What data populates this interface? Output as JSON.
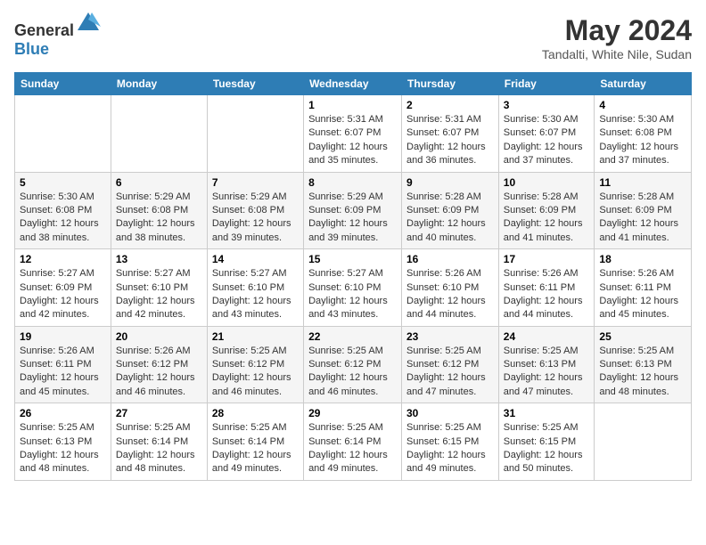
{
  "logo": {
    "general": "General",
    "blue": "Blue"
  },
  "title": "May 2024",
  "location": "Tandalti, White Nile, Sudan",
  "days_header": [
    "Sunday",
    "Monday",
    "Tuesday",
    "Wednesday",
    "Thursday",
    "Friday",
    "Saturday"
  ],
  "weeks": [
    [
      {
        "day": "",
        "sunrise": "",
        "sunset": "",
        "daylight": ""
      },
      {
        "day": "",
        "sunrise": "",
        "sunset": "",
        "daylight": ""
      },
      {
        "day": "",
        "sunrise": "",
        "sunset": "",
        "daylight": ""
      },
      {
        "day": "1",
        "sunrise": "Sunrise: 5:31 AM",
        "sunset": "Sunset: 6:07 PM",
        "daylight": "Daylight: 12 hours and 35 minutes."
      },
      {
        "day": "2",
        "sunrise": "Sunrise: 5:31 AM",
        "sunset": "Sunset: 6:07 PM",
        "daylight": "Daylight: 12 hours and 36 minutes."
      },
      {
        "day": "3",
        "sunrise": "Sunrise: 5:30 AM",
        "sunset": "Sunset: 6:07 PM",
        "daylight": "Daylight: 12 hours and 37 minutes."
      },
      {
        "day": "4",
        "sunrise": "Sunrise: 5:30 AM",
        "sunset": "Sunset: 6:08 PM",
        "daylight": "Daylight: 12 hours and 37 minutes."
      }
    ],
    [
      {
        "day": "5",
        "sunrise": "Sunrise: 5:30 AM",
        "sunset": "Sunset: 6:08 PM",
        "daylight": "Daylight: 12 hours and 38 minutes."
      },
      {
        "day": "6",
        "sunrise": "Sunrise: 5:29 AM",
        "sunset": "Sunset: 6:08 PM",
        "daylight": "Daylight: 12 hours and 38 minutes."
      },
      {
        "day": "7",
        "sunrise": "Sunrise: 5:29 AM",
        "sunset": "Sunset: 6:08 PM",
        "daylight": "Daylight: 12 hours and 39 minutes."
      },
      {
        "day": "8",
        "sunrise": "Sunrise: 5:29 AM",
        "sunset": "Sunset: 6:09 PM",
        "daylight": "Daylight: 12 hours and 39 minutes."
      },
      {
        "day": "9",
        "sunrise": "Sunrise: 5:28 AM",
        "sunset": "Sunset: 6:09 PM",
        "daylight": "Daylight: 12 hours and 40 minutes."
      },
      {
        "day": "10",
        "sunrise": "Sunrise: 5:28 AM",
        "sunset": "Sunset: 6:09 PM",
        "daylight": "Daylight: 12 hours and 41 minutes."
      },
      {
        "day": "11",
        "sunrise": "Sunrise: 5:28 AM",
        "sunset": "Sunset: 6:09 PM",
        "daylight": "Daylight: 12 hours and 41 minutes."
      }
    ],
    [
      {
        "day": "12",
        "sunrise": "Sunrise: 5:27 AM",
        "sunset": "Sunset: 6:09 PM",
        "daylight": "Daylight: 12 hours and 42 minutes."
      },
      {
        "day": "13",
        "sunrise": "Sunrise: 5:27 AM",
        "sunset": "Sunset: 6:10 PM",
        "daylight": "Daylight: 12 hours and 42 minutes."
      },
      {
        "day": "14",
        "sunrise": "Sunrise: 5:27 AM",
        "sunset": "Sunset: 6:10 PM",
        "daylight": "Daylight: 12 hours and 43 minutes."
      },
      {
        "day": "15",
        "sunrise": "Sunrise: 5:27 AM",
        "sunset": "Sunset: 6:10 PM",
        "daylight": "Daylight: 12 hours and 43 minutes."
      },
      {
        "day": "16",
        "sunrise": "Sunrise: 5:26 AM",
        "sunset": "Sunset: 6:10 PM",
        "daylight": "Daylight: 12 hours and 44 minutes."
      },
      {
        "day": "17",
        "sunrise": "Sunrise: 5:26 AM",
        "sunset": "Sunset: 6:11 PM",
        "daylight": "Daylight: 12 hours and 44 minutes."
      },
      {
        "day": "18",
        "sunrise": "Sunrise: 5:26 AM",
        "sunset": "Sunset: 6:11 PM",
        "daylight": "Daylight: 12 hours and 45 minutes."
      }
    ],
    [
      {
        "day": "19",
        "sunrise": "Sunrise: 5:26 AM",
        "sunset": "Sunset: 6:11 PM",
        "daylight": "Daylight: 12 hours and 45 minutes."
      },
      {
        "day": "20",
        "sunrise": "Sunrise: 5:26 AM",
        "sunset": "Sunset: 6:12 PM",
        "daylight": "Daylight: 12 hours and 46 minutes."
      },
      {
        "day": "21",
        "sunrise": "Sunrise: 5:25 AM",
        "sunset": "Sunset: 6:12 PM",
        "daylight": "Daylight: 12 hours and 46 minutes."
      },
      {
        "day": "22",
        "sunrise": "Sunrise: 5:25 AM",
        "sunset": "Sunset: 6:12 PM",
        "daylight": "Daylight: 12 hours and 46 minutes."
      },
      {
        "day": "23",
        "sunrise": "Sunrise: 5:25 AM",
        "sunset": "Sunset: 6:12 PM",
        "daylight": "Daylight: 12 hours and 47 minutes."
      },
      {
        "day": "24",
        "sunrise": "Sunrise: 5:25 AM",
        "sunset": "Sunset: 6:13 PM",
        "daylight": "Daylight: 12 hours and 47 minutes."
      },
      {
        "day": "25",
        "sunrise": "Sunrise: 5:25 AM",
        "sunset": "Sunset: 6:13 PM",
        "daylight": "Daylight: 12 hours and 48 minutes."
      }
    ],
    [
      {
        "day": "26",
        "sunrise": "Sunrise: 5:25 AM",
        "sunset": "Sunset: 6:13 PM",
        "daylight": "Daylight: 12 hours and 48 minutes."
      },
      {
        "day": "27",
        "sunrise": "Sunrise: 5:25 AM",
        "sunset": "Sunset: 6:14 PM",
        "daylight": "Daylight: 12 hours and 48 minutes."
      },
      {
        "day": "28",
        "sunrise": "Sunrise: 5:25 AM",
        "sunset": "Sunset: 6:14 PM",
        "daylight": "Daylight: 12 hours and 49 minutes."
      },
      {
        "day": "29",
        "sunrise": "Sunrise: 5:25 AM",
        "sunset": "Sunset: 6:14 PM",
        "daylight": "Daylight: 12 hours and 49 minutes."
      },
      {
        "day": "30",
        "sunrise": "Sunrise: 5:25 AM",
        "sunset": "Sunset: 6:15 PM",
        "daylight": "Daylight: 12 hours and 49 minutes."
      },
      {
        "day": "31",
        "sunrise": "Sunrise: 5:25 AM",
        "sunset": "Sunset: 6:15 PM",
        "daylight": "Daylight: 12 hours and 50 minutes."
      },
      {
        "day": "",
        "sunrise": "",
        "sunset": "",
        "daylight": ""
      }
    ]
  ]
}
